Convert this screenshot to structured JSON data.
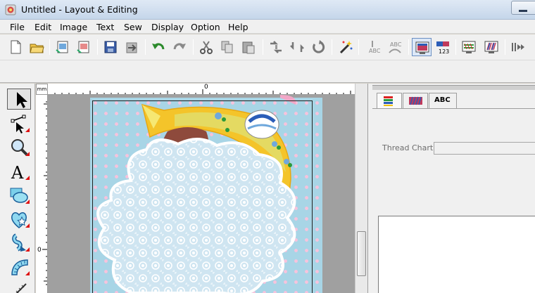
{
  "window": {
    "title": "Untitled - Layout & Editing"
  },
  "menu": [
    "File",
    "Edit",
    "Image",
    "Text",
    "Sew",
    "Display",
    "Option",
    "Help"
  ],
  "toolbar": {
    "buttons": [
      {
        "name": "new-file-icon"
      },
      {
        "name": "open-folder-icon"
      },
      {
        "name": "import-image-icon"
      },
      {
        "name": "import-embroidery-icon"
      },
      {
        "name": "save-icon"
      },
      {
        "name": "export-icon"
      },
      {
        "name": "undo-icon"
      },
      {
        "name": "redo-icon"
      },
      {
        "name": "cut-icon"
      },
      {
        "name": "copy-icon"
      },
      {
        "name": "paste-icon"
      },
      {
        "name": "flip-horizontal-icon"
      },
      {
        "name": "flip-vertical-icon"
      },
      {
        "name": "rotate-icon"
      },
      {
        "name": "magic-wand-icon"
      },
      {
        "name": "text-arrange-icon"
      },
      {
        "name": "text-arc-icon"
      },
      {
        "name": "design-page-icon"
      },
      {
        "name": "sewing-order-icon"
      },
      {
        "name": "stitch-simulator-icon"
      },
      {
        "name": "realistic-preview-icon"
      },
      {
        "name": "transfer-icon"
      }
    ]
  },
  "palette": [
    "select-arrow-icon",
    "point-edit-icon",
    "zoom-icon",
    "text-tool-icon",
    "shape-tool-icon",
    "stamp-tool-icon",
    "outline-tool-icon",
    "brush-tool-icon",
    "measure-tool-icon"
  ],
  "rulers": {
    "unit": "mm",
    "top_zero": "0",
    "left_zero": "0"
  },
  "side_panel": {
    "tabs": [
      {
        "name": "tab-sew-attributes",
        "label": ""
      },
      {
        "name": "tab-region-stitch",
        "label": ""
      },
      {
        "name": "tab-text-attributes",
        "label": "ABC"
      }
    ],
    "thread_chart_label": "Thread Chart:",
    "thread_chart_value": ""
  },
  "colors": {
    "hoop_background": "#a8d5e6",
    "polka_dot": "#f6c3dc",
    "canvas_gray": "#a0a0a0",
    "ribbon_yellow": "#f4c42a"
  }
}
